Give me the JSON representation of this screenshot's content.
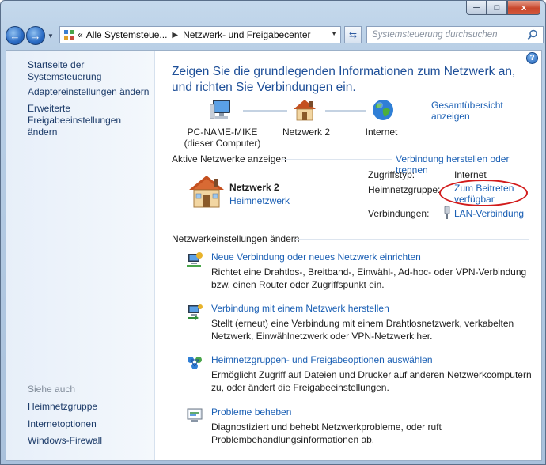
{
  "window": {
    "caption_buttons": {
      "minimize": "─",
      "maximize": "□",
      "close": "x"
    }
  },
  "navbar": {
    "back_icon": "back-arrow-icon",
    "forward_icon": "forward-arrow-icon",
    "breadcrumb_prefix": "«",
    "breadcrumbs": [
      "Alle Systemsteue...",
      "Netzwerk- und Freigabecenter"
    ],
    "search_placeholder": "Systemsteuerung durchsuchen"
  },
  "sidebar": {
    "links": [
      "Startseite der Systemsteuerung",
      "Adaptereinstellungen ändern",
      "Erweiterte Freigabeeinstellungen ändern"
    ],
    "see_also_heading": "Siehe auch",
    "see_also": [
      "Heimnetzgruppe",
      "Internetoptionen",
      "Windows-Firewall"
    ]
  },
  "main": {
    "title": "Zeigen Sie die grundlegenden Informationen zum Netzwerk an, und richten Sie Verbindungen ein.",
    "overview_link": "Gesamtübersicht anzeigen",
    "map": [
      {
        "label": "PC-NAME-MIKE",
        "sublabel": "(dieser Computer)",
        "icon": "computer-icon"
      },
      {
        "label": "Netzwerk  2",
        "sublabel": "",
        "icon": "house-icon"
      },
      {
        "label": "Internet",
        "sublabel": "",
        "icon": "globe-icon"
      }
    ],
    "active_networks_heading": "Aktive Netzwerke anzeigen",
    "connect_link": "Verbindung herstellen oder trennen",
    "network": {
      "name": "Netzwerk  2",
      "type": "Heimnetzwerk",
      "access_label": "Zugriffstyp:",
      "access_value": "Internet",
      "homegroup_label": "Heimnetzgruppe:",
      "homegroup_value": "Zum Beitreten verfügbar",
      "connections_label": "Verbindungen:",
      "connections_value": "LAN-Verbindung"
    },
    "settings_heading": "Netzwerkeinstellungen ändern",
    "tasks": [
      {
        "title": "Neue Verbindung oder neues Netzwerk einrichten",
        "description": "Richtet eine Drahtlos-, Breitband-, Einwähl-, Ad-hoc- oder VPN-Verbindung bzw. einen Router oder Zugriffspunkt ein.",
        "icon": "new-connection-icon"
      },
      {
        "title": "Verbindung mit einem Netzwerk herstellen",
        "description": "Stellt (erneut) eine Verbindung mit einem Drahtlosnetzwerk, verkabelten Netzwerk, Einwählnetzwerk oder VPN-Netzwerk her.",
        "icon": "connect-network-icon"
      },
      {
        "title": "Heimnetzgruppen- und Freigabeoptionen auswählen",
        "description": "Ermöglicht Zugriff auf Dateien und Drucker auf anderen Netzwerkcomputern zu, oder ändert die Freigabeeinstellungen.",
        "icon": "homegroup-icon"
      },
      {
        "title": "Probleme beheben",
        "description": "Diagnostiziert und behebt Netzwerkprobleme, oder ruft Problembehandlungsinformationen ab.",
        "icon": "troubleshoot-icon"
      }
    ]
  }
}
